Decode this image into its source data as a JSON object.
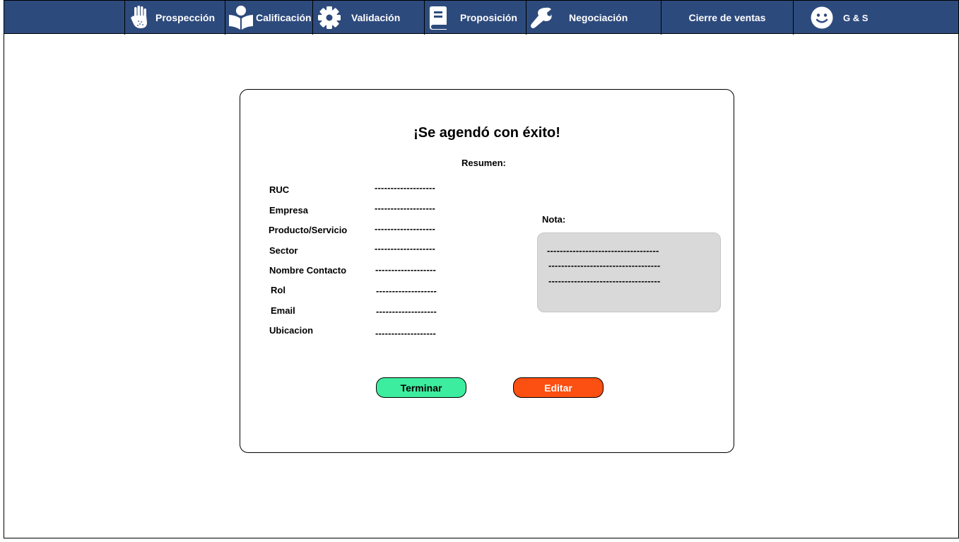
{
  "nav": {
    "items": [
      {
        "label": "Prospección",
        "icon": "hand-icon"
      },
      {
        "label": "Calificación",
        "icon": "reading-person-icon"
      },
      {
        "label": "Validación",
        "icon": "gear-icon"
      },
      {
        "label": "Proposición",
        "icon": "book-icon"
      },
      {
        "label": "Negociación",
        "icon": "wrench-icon"
      },
      {
        "label": "Cierre de ventas",
        "icon": ""
      }
    ],
    "user": {
      "label": "G & S",
      "icon": "smiley-icon"
    },
    "colors": {
      "bar": "#2d4a7c",
      "text": "#ffffff"
    }
  },
  "dialog": {
    "title": "¡Se agendó con éxito!",
    "summary_label": "Resumen:",
    "fields": [
      {
        "label": "RUC",
        "value": "-------------------"
      },
      {
        "label": "Empresa",
        "value": "-------------------"
      },
      {
        "label": "Producto/Servicio",
        "value": "-------------------"
      },
      {
        "label": "Sector",
        "value": "-------------------"
      },
      {
        "label": "Nombre Contacto",
        "value": "-------------------"
      },
      {
        "label": "Rol",
        "value": "-------------------"
      },
      {
        "label": "Email",
        "value": "-------------------"
      },
      {
        "label": "Ubicacion",
        "value": "-------------------"
      }
    ],
    "note": {
      "label": "Nota:",
      "lines": [
        "-----------------------------------",
        "-----------------------------------",
        "-----------------------------------"
      ]
    },
    "buttons": {
      "finish": "Terminar",
      "edit": "Editar"
    },
    "colors": {
      "finish": "#3ded9f",
      "edit": "#fc4f12",
      "note_bg": "#d9d9d9"
    }
  }
}
